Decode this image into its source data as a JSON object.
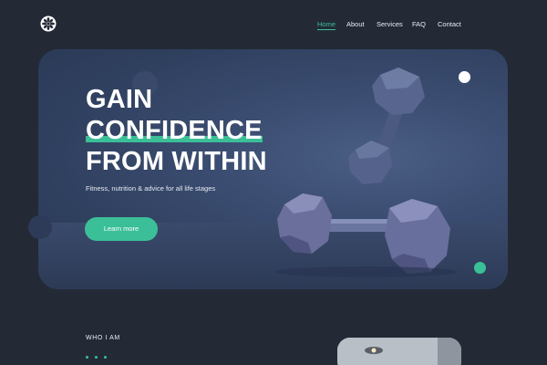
{
  "header": {
    "logo_icon": "flower-logo-icon",
    "nav": [
      {
        "label": "Home",
        "active": true
      },
      {
        "label": "About",
        "active": false
      },
      {
        "label": "Services",
        "active": false
      },
      {
        "label": "FAQ",
        "active": false
      },
      {
        "label": "Contact",
        "active": false
      }
    ]
  },
  "hero": {
    "title_line1": "GAIN",
    "title_line2": "CONFIDENCE",
    "title_line3": "FROM WITHIN",
    "subtitle": "Fitness, nutrition & advice for all life stages",
    "button_label": "Learn more",
    "image_icon": "dumbbells-image"
  },
  "about": {
    "heading": "WHO I AM",
    "image_icon": "interior-photo"
  },
  "colors": {
    "background": "#232a36",
    "accent": "#3bbf98",
    "hero": "#3a4c70"
  }
}
